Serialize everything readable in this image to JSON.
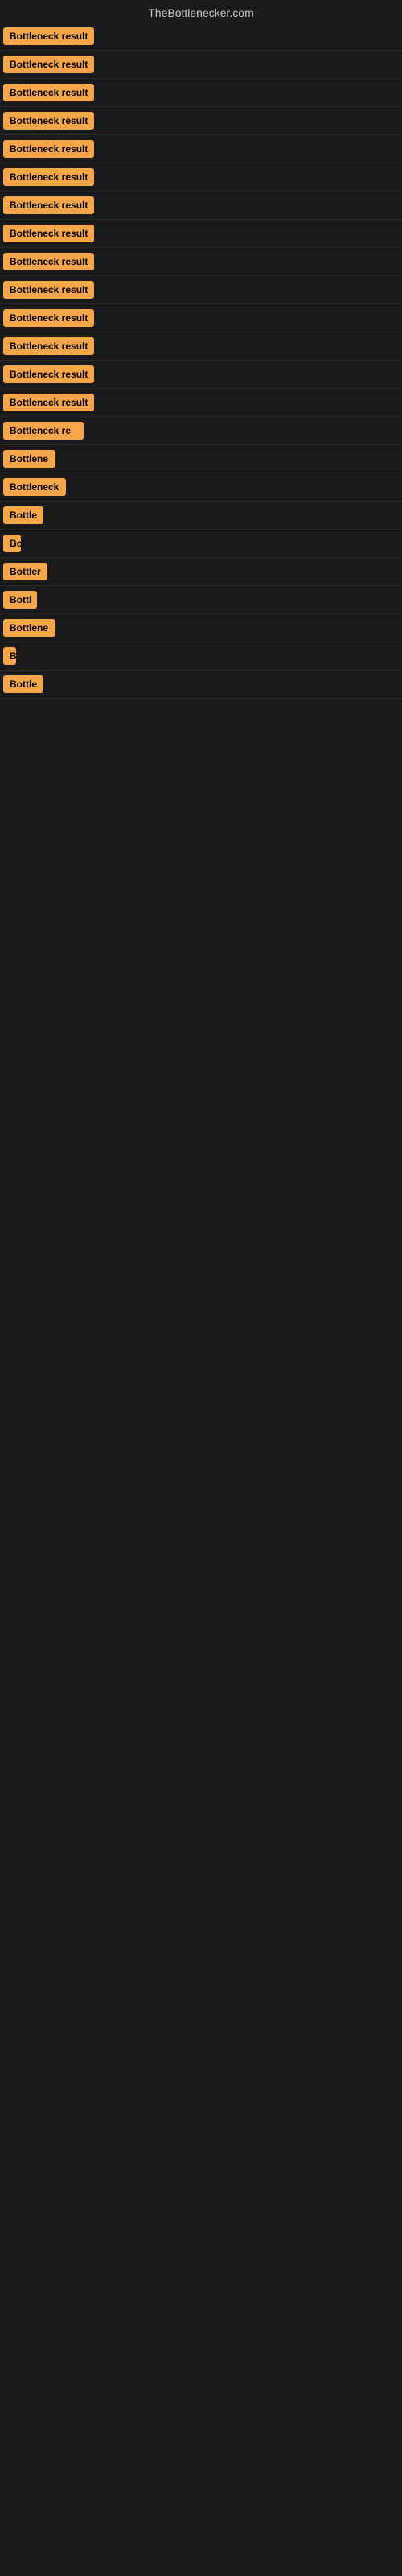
{
  "header": {
    "title": "TheBottlenecker.com"
  },
  "results": [
    {
      "id": 1,
      "label": "Bottleneck result",
      "truncated": false
    },
    {
      "id": 2,
      "label": "Bottleneck result",
      "truncated": false
    },
    {
      "id": 3,
      "label": "Bottleneck result",
      "truncated": false
    },
    {
      "id": 4,
      "label": "Bottleneck result",
      "truncated": false
    },
    {
      "id": 5,
      "label": "Bottleneck result",
      "truncated": false
    },
    {
      "id": 6,
      "label": "Bottleneck result",
      "truncated": false
    },
    {
      "id": 7,
      "label": "Bottleneck result",
      "truncated": false
    },
    {
      "id": 8,
      "label": "Bottleneck result",
      "truncated": false
    },
    {
      "id": 9,
      "label": "Bottleneck result",
      "truncated": false
    },
    {
      "id": 10,
      "label": "Bottleneck result",
      "truncated": false
    },
    {
      "id": 11,
      "label": "Bottleneck result",
      "truncated": false
    },
    {
      "id": 12,
      "label": "Bottleneck result",
      "truncated": false
    },
    {
      "id": 13,
      "label": "Bottleneck result",
      "truncated": false
    },
    {
      "id": 14,
      "label": "Bottleneck result",
      "truncated": false
    },
    {
      "id": 15,
      "label": "Bottleneck re",
      "truncated": true
    },
    {
      "id": 16,
      "label": "Bottlene",
      "truncated": true
    },
    {
      "id": 17,
      "label": "Bottleneck",
      "truncated": true
    },
    {
      "id": 18,
      "label": "Bottle",
      "truncated": true
    },
    {
      "id": 19,
      "label": "Bo",
      "truncated": true
    },
    {
      "id": 20,
      "label": "Bottler",
      "truncated": true
    },
    {
      "id": 21,
      "label": "Bottl",
      "truncated": true
    },
    {
      "id": 22,
      "label": "Bottlene",
      "truncated": true
    },
    {
      "id": 23,
      "label": "B",
      "truncated": true
    },
    {
      "id": 24,
      "label": "Bottle",
      "truncated": true
    }
  ]
}
